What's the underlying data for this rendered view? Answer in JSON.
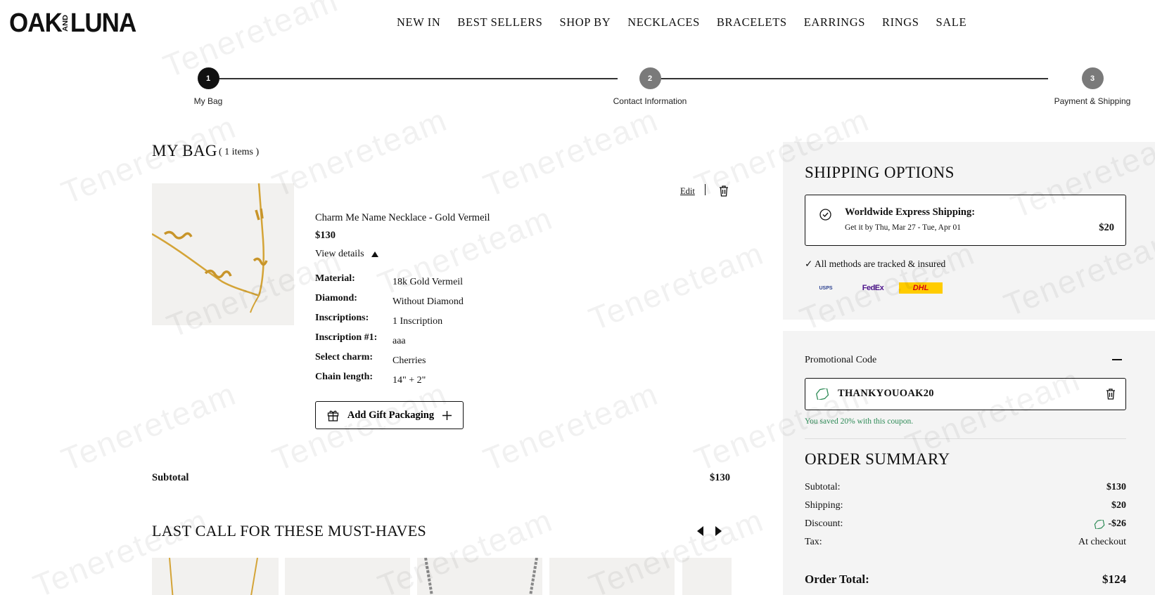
{
  "brand": {
    "logo_left": "OAK",
    "logo_mid": "AND",
    "logo_right": "LUNA"
  },
  "nav": [
    "NEW IN",
    "BEST SELLERS",
    "SHOP BY",
    "NECKLACES",
    "BRACELETS",
    "EARRINGS",
    "RINGS",
    "SALE"
  ],
  "stepper": {
    "steps": [
      {
        "number": "1",
        "label": "My Bag",
        "active": true
      },
      {
        "number": "2",
        "label": "Contact Information",
        "active": false
      },
      {
        "number": "3",
        "label": "Payment & Shipping",
        "active": false
      }
    ]
  },
  "bag": {
    "title": "MY BAG",
    "count": "( 1 items )",
    "edit_label": "Edit",
    "item": {
      "name": "Charm Me Name Necklace - Gold Vermeil",
      "price": "$130",
      "view_details": "View details",
      "details": [
        {
          "label": "Material:",
          "value": "18k Gold Vermeil"
        },
        {
          "label": "Diamond:",
          "value": "Without Diamond"
        },
        {
          "label": "Inscriptions:",
          "value": "1 Inscription"
        },
        {
          "label": "Inscription #1:",
          "value": "aaa"
        },
        {
          "label": "Select charm:",
          "value": "Cherries"
        },
        {
          "label": "Chain length:",
          "value": "14\" + 2\""
        }
      ]
    },
    "gift_label": "Add Gift Packaging",
    "subtotal_label": "Subtotal",
    "subtotal_value": "$130"
  },
  "lastcall": {
    "title": "LAST CALL FOR THESE MUST-HAVES"
  },
  "shipping": {
    "title": "SHIPPING OPTIONS",
    "option_name": "Worldwide Express Shipping:",
    "option_eta": "Get it by Thu, Mar 27 - Tue, Apr 01",
    "option_price": "$20",
    "tracked": "✓ All methods are tracked & insured",
    "carriers": [
      "USPS",
      "FedEx",
      "DHL"
    ]
  },
  "promo": {
    "label": "Promotional Code",
    "code": "THANKYOUOAK20",
    "saved": "You saved 20% with this coupon."
  },
  "summary": {
    "title": "ORDER SUMMARY",
    "rows": [
      {
        "label": "Subtotal:",
        "value": "$130"
      },
      {
        "label": "Shipping:",
        "value": "$20"
      },
      {
        "label": "Discount:",
        "value": "-$26"
      },
      {
        "label": "Tax:",
        "value": "At checkout"
      }
    ],
    "total_label": "Order Total:",
    "total_value": "$124"
  },
  "watermark": "Tenereteam",
  "colors": {
    "accent": "#111111",
    "step_inactive": "#7a7a7a",
    "panel": "#f4f4f4",
    "success": "#2e8b57",
    "gold": "#d4a437"
  }
}
